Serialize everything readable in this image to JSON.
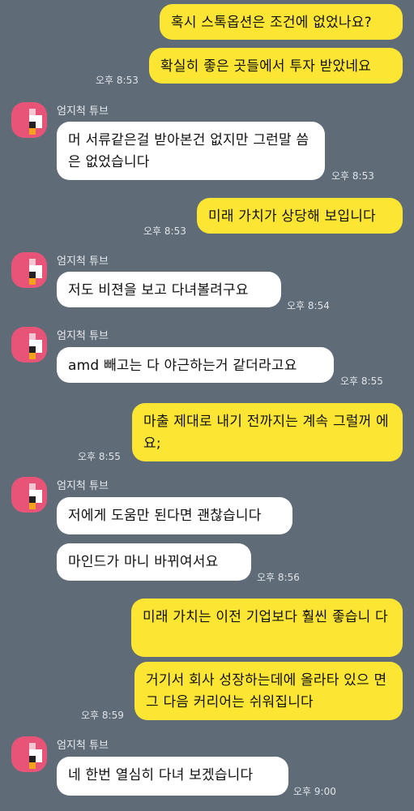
{
  "sender_name": "엄지척 튜브",
  "messages": [
    {
      "text": "혹시 스톡옵션은 조건에 없었나요?"
    },
    {
      "text": "확실히 좋은 곳들에서 투자 받았네요",
      "time": "오후 8:53"
    },
    {
      "text": "머 서류같은걸 받아본건 없지만 그런말 씀은 없었습니다",
      "time": "오후 8:53"
    },
    {
      "text": "미래 가치가 상당해 보입니다",
      "time": "오후 8:53"
    },
    {
      "text": "저도 비젼을 보고 다녀볼려구요",
      "time": "오후 8:54"
    },
    {
      "text": "amd 빼고는 다 야근하는거 같더라고요",
      "time": "오후 8:55"
    },
    {
      "text": "마출 제대로 내기 전까지는 계속 그럴꺼 에요;",
      "time": "오후 8:55"
    },
    {
      "text": "저에게 도움만 된다면 괜찮습니다"
    },
    {
      "text": "마인드가 마니 바뀌여서요",
      "time": "오후 8:56"
    },
    {
      "text": "미래 가치는 이전 기업보다 훨씬 좋습니 다"
    },
    {
      "text": "거기서 회사 성장하는데에 올라타 있으 면 그 다음 커리어는 쉬워집니다",
      "time": "오후 8:59"
    },
    {
      "text": "네 한번 열심히 다녀 보겠습니다",
      "time": "오후 9:00"
    }
  ],
  "colors": {
    "my_bubble": "#fde533",
    "their_bubble": "#ffffff",
    "background": "#5f6b77",
    "avatar": "#e85477"
  },
  "icons": {
    "avatar": "pixel-avatar-icon"
  }
}
